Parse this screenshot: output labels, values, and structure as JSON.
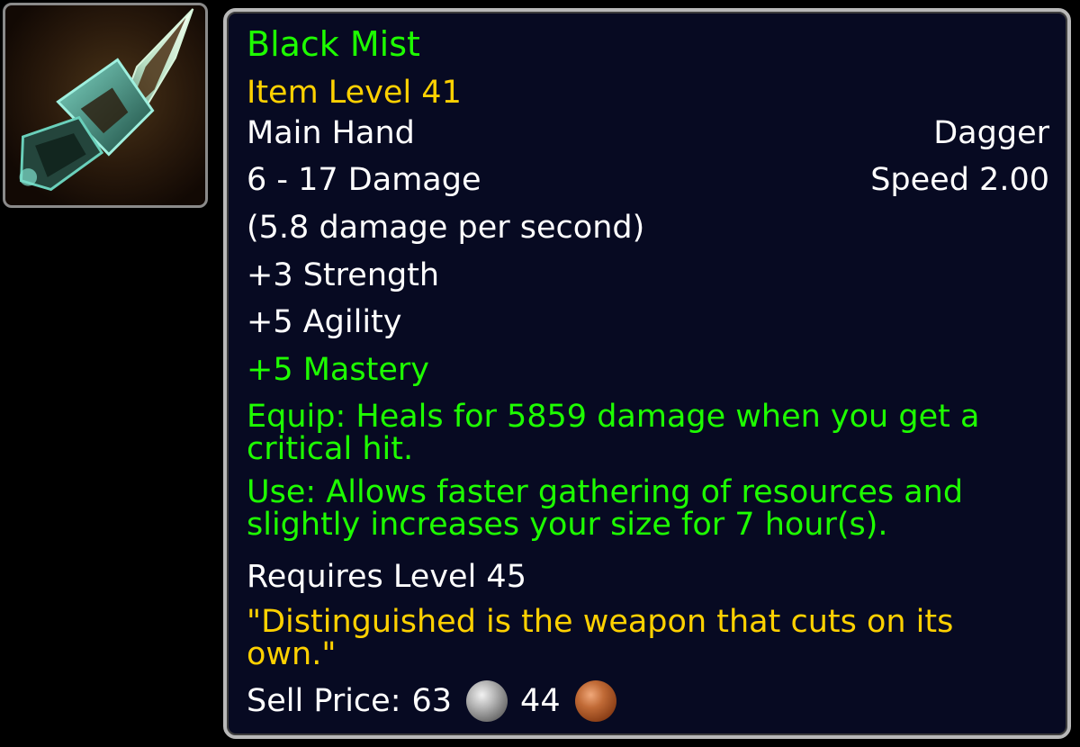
{
  "item": {
    "name": "Black Mist",
    "item_level": "Item Level 41",
    "slot": "Main Hand",
    "type": "Dagger",
    "damage": "6 - 17 Damage",
    "speed": "Speed 2.00",
    "dps": "(5.8 damage per second)",
    "stats": {
      "strength": "+3 Strength",
      "agility": "+5 Agility",
      "mastery": "+5 Mastery"
    },
    "equip_effect": "Equip: Heals for 5859 damage when you get a critical hit.",
    "use_effect": "Use: Allows faster gathering of resources and slightly increases your size for 7 hour(s).",
    "requirement": "Requires Level 45",
    "flavor_text": "\"Distinguished is the weapon that cuts on its own.\"",
    "sell_price": {
      "label": "Sell Price:",
      "silver": "63",
      "copper": "44"
    }
  },
  "icons": {
    "item_icon": "dagger-icon",
    "silver": "silver-coin-icon",
    "copper": "copper-coin-icon"
  },
  "colors": {
    "name": "#1eff00",
    "item_level": "#ffd100",
    "bonus_stat": "#1eff00",
    "effect": "#1eff00",
    "flavor": "#ffd100",
    "text": "#ffffff",
    "background": "#070a22",
    "border": "#b8b8b8"
  }
}
